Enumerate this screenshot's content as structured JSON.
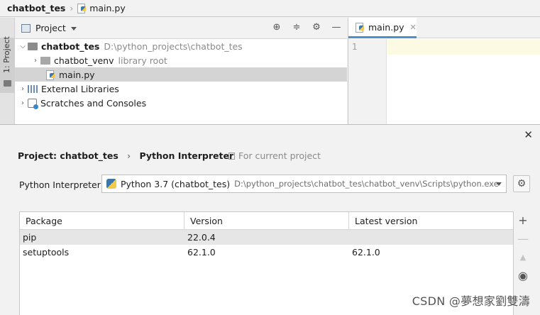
{
  "nav": {
    "project": "chatbot_tes",
    "file": "main.py"
  },
  "side_tool_window": {
    "label": "1: Project"
  },
  "project_panel": {
    "header": "Project",
    "tree": [
      {
        "name": "chatbot_tes",
        "hint": "D:\\python_projects\\chatbot_tes",
        "expanded": true,
        "bold": true
      },
      {
        "name": "chatbot_venv",
        "hint": "library root",
        "expanded": false
      },
      {
        "name": "main.py",
        "hint": "",
        "selected": true
      },
      {
        "name": "External Libraries",
        "hint": ""
      },
      {
        "name": "Scratches and Consoles",
        "hint": ""
      }
    ]
  },
  "editor": {
    "tab": "main.py",
    "line_number": "1"
  },
  "dialog": {
    "breadcrumb_parent": "Project: chatbot_tes",
    "breadcrumb_current": "Python Interpreter",
    "scope": "For current project",
    "interpreter_label": "Python Interpreter:",
    "interpreter_name": "Python 3.7 (chatbot_tes)",
    "interpreter_path": "D:\\python_projects\\chatbot_tes\\chatbot_venv\\Scripts\\python.exe",
    "columns": [
      "Package",
      "Version",
      "Latest version"
    ],
    "packages": [
      {
        "package": "pip",
        "version": "22.0.4",
        "latest": ""
      },
      {
        "package": "setuptools",
        "version": "62.1.0",
        "latest": "62.1.0"
      }
    ]
  },
  "watermark": "CSDN @夢想家劉雙濤",
  "colors": {
    "selection": "#d4d4d4",
    "accent_tab": "#4d8ed0",
    "current_line": "#fcfae3"
  }
}
